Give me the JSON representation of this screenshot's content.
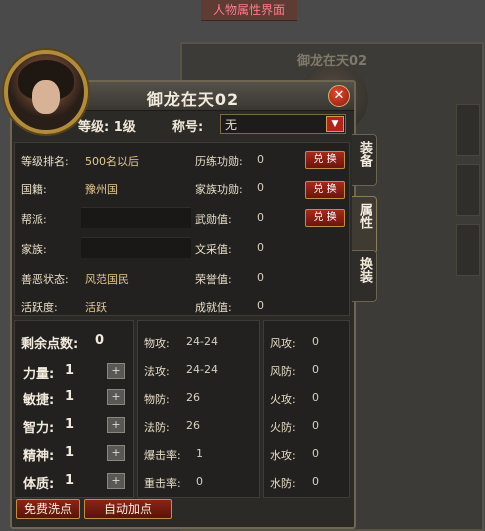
{
  "caption": "人物属性界面",
  "ghost_title": "御龙在天02",
  "window": {
    "title": "御龙在天02",
    "close_glyph": "✕"
  },
  "header": {
    "level_label": "等级:",
    "level_value": "1级",
    "title_label": "称号:",
    "title_value": "无",
    "dropdown_glyph": "▼"
  },
  "info_rows_left": [
    {
      "label": "等级排名:",
      "value": "500名以后"
    },
    {
      "label": "国籍:",
      "value": "豫州国"
    },
    {
      "label": "帮派:",
      "value": ""
    },
    {
      "label": "家族:",
      "value": ""
    },
    {
      "label": "善恶状态:",
      "value": "风范国民"
    },
    {
      "label": "活跃度:",
      "value": "活跃"
    }
  ],
  "info_rows_right": [
    {
      "label": "历练功勋:",
      "value": "0",
      "button": "兑 换"
    },
    {
      "label": "家族功勋:",
      "value": "0",
      "button": "兑 换"
    },
    {
      "label": "武勋值:",
      "value": "0",
      "button": "兑 换"
    },
    {
      "label": "文采值:",
      "value": "0"
    },
    {
      "label": "荣誉值:",
      "value": "0"
    },
    {
      "label": "成就值:",
      "value": "0"
    }
  ],
  "tabs": [
    "装备",
    "属性",
    "换装"
  ],
  "points": {
    "title": "剩余点数:",
    "value": "0",
    "attrs": [
      {
        "label": "力量:",
        "value": "1"
      },
      {
        "label": "敏捷:",
        "value": "1"
      },
      {
        "label": "智力:",
        "value": "1"
      },
      {
        "label": "精神:",
        "value": "1"
      },
      {
        "label": "体质:",
        "value": "1"
      }
    ],
    "plus_glyph": "+"
  },
  "combat": [
    {
      "label": "物攻:",
      "value": "24-24"
    },
    {
      "label": "法攻:",
      "value": "24-24"
    },
    {
      "label": "物防:",
      "value": "26"
    },
    {
      "label": "法防:",
      "value": "26"
    },
    {
      "label": "爆击率:",
      "value": "1"
    },
    {
      "label": "重击率:",
      "value": "0"
    }
  ],
  "elements": [
    {
      "label": "风攻:",
      "value": "0"
    },
    {
      "label": "风防:",
      "value": "0"
    },
    {
      "label": "火攻:",
      "value": "0"
    },
    {
      "label": "火防:",
      "value": "0"
    },
    {
      "label": "水攻:",
      "value": "0"
    },
    {
      "label": "水防:",
      "value": "0"
    }
  ],
  "buttons": {
    "free_reset": "免费洗点",
    "auto_add": "自动加点"
  }
}
